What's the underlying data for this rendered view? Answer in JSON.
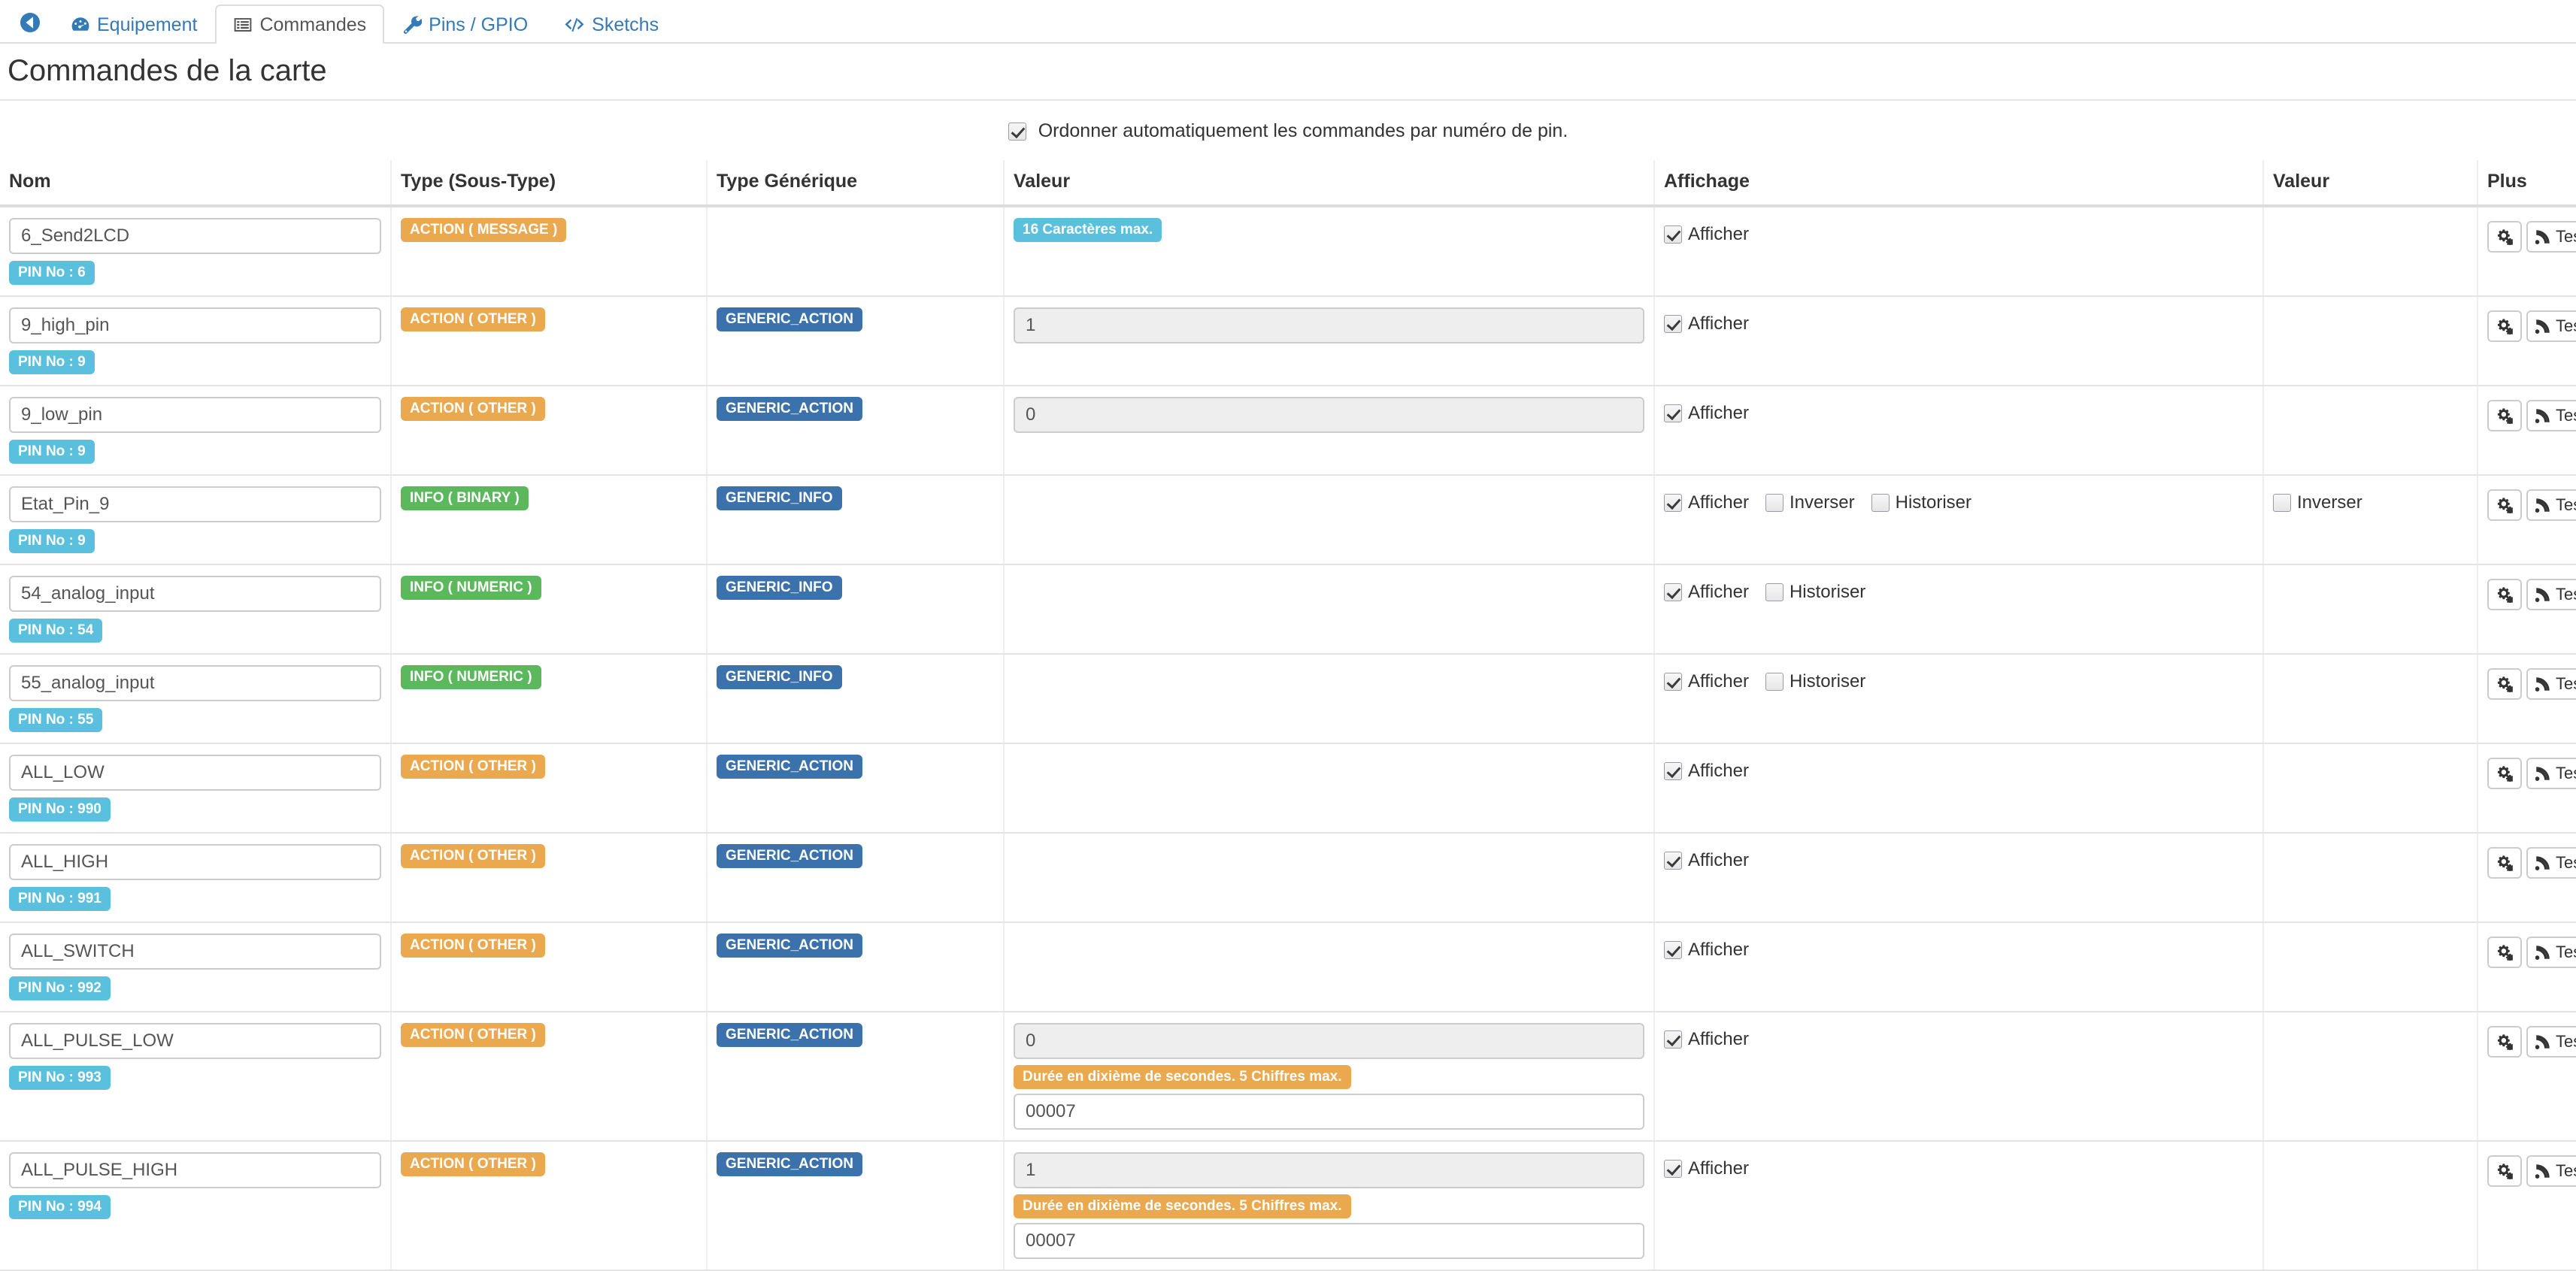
{
  "tabs": {
    "back_icon": "back-circle-icon",
    "items": [
      {
        "id": "equipement",
        "label": "Equipement",
        "icon": "dashboard-icon",
        "active": false
      },
      {
        "id": "commandes",
        "label": "Commandes",
        "icon": "list-alt-icon",
        "active": true
      },
      {
        "id": "pins-gpio",
        "label": "Pins / GPIO",
        "icon": "wrench-icon",
        "active": false
      },
      {
        "id": "sketchs",
        "label": "Sketchs",
        "icon": "code-icon",
        "active": false
      }
    ]
  },
  "page": {
    "title": "Commandes de la carte"
  },
  "order_option": {
    "label": "Ordonner automatiquement les commandes par numéro de pin.",
    "checked": true
  },
  "table": {
    "headers": {
      "nom": "Nom",
      "type": "Type (Sous-Type)",
      "generique": "Type Générique",
      "valeur": "Valeur",
      "affichage": "Affichage",
      "valeur2": "Valeur",
      "plus": "Plus"
    },
    "labels": {
      "afficher": "Afficher",
      "inverser": "Inverser",
      "historiser": "Historiser",
      "tester": "Tester",
      "config_icon": "cogs-icon",
      "tester_icon": "rss-signal-icon"
    },
    "rows": [
      {
        "name": "6_Send2LCD",
        "pin": "PIN No : 6",
        "type": "ACTION ( MESSAGE )",
        "type_color": "orange",
        "generic": "",
        "generic_color": "",
        "value": null,
        "value_hint": null,
        "value_extra": null,
        "value_info": "16 Caractères max.",
        "afficher": true,
        "inverser": null,
        "historiser": null,
        "valeur2_inverser": null
      },
      {
        "name": "9_high_pin",
        "pin": "PIN No : 9",
        "type": "ACTION ( OTHER )",
        "type_color": "orange",
        "generic": "GENERIC_ACTION",
        "generic_color": "blue",
        "value": "1",
        "value_hint": null,
        "value_extra": null,
        "value_info": null,
        "afficher": true,
        "inverser": null,
        "historiser": null,
        "valeur2_inverser": null
      },
      {
        "name": "9_low_pin",
        "pin": "PIN No : 9",
        "type": "ACTION ( OTHER )",
        "type_color": "orange",
        "generic": "GENERIC_ACTION",
        "generic_color": "blue",
        "value": "0",
        "value_hint": null,
        "value_extra": null,
        "value_info": null,
        "afficher": true,
        "inverser": null,
        "historiser": null,
        "valeur2_inverser": null
      },
      {
        "name": "Etat_Pin_9",
        "pin": "PIN No : 9",
        "type": "INFO ( BINARY )",
        "type_color": "green",
        "generic": "GENERIC_INFO",
        "generic_color": "blue",
        "value": null,
        "value_hint": null,
        "value_extra": null,
        "value_info": null,
        "afficher": true,
        "inverser": false,
        "historiser": false,
        "valeur2_inverser": false
      },
      {
        "name": "54_analog_input",
        "pin": "PIN No : 54",
        "type": "INFO ( NUMERIC )",
        "type_color": "green",
        "generic": "GENERIC_INFO",
        "generic_color": "blue",
        "value": null,
        "value_hint": null,
        "value_extra": null,
        "value_info": null,
        "afficher": true,
        "inverser": null,
        "historiser": false,
        "valeur2_inverser": null
      },
      {
        "name": "55_analog_input",
        "pin": "PIN No : 55",
        "type": "INFO ( NUMERIC )",
        "type_color": "green",
        "generic": "GENERIC_INFO",
        "generic_color": "blue",
        "value": null,
        "value_hint": null,
        "value_extra": null,
        "value_info": null,
        "afficher": true,
        "inverser": null,
        "historiser": false,
        "valeur2_inverser": null
      },
      {
        "name": "ALL_LOW",
        "pin": "PIN No : 990",
        "type": "ACTION ( OTHER )",
        "type_color": "orange",
        "generic": "GENERIC_ACTION",
        "generic_color": "blue",
        "value": null,
        "value_hint": null,
        "value_extra": null,
        "value_info": null,
        "afficher": true,
        "inverser": null,
        "historiser": null,
        "valeur2_inverser": null
      },
      {
        "name": "ALL_HIGH",
        "pin": "PIN No : 991",
        "type": "ACTION ( OTHER )",
        "type_color": "orange",
        "generic": "GENERIC_ACTION",
        "generic_color": "blue",
        "value": null,
        "value_hint": null,
        "value_extra": null,
        "value_info": null,
        "afficher": true,
        "inverser": null,
        "historiser": null,
        "valeur2_inverser": null
      },
      {
        "name": "ALL_SWITCH",
        "pin": "PIN No : 992",
        "type": "ACTION ( OTHER )",
        "type_color": "orange",
        "generic": "GENERIC_ACTION",
        "generic_color": "blue",
        "value": null,
        "value_hint": null,
        "value_extra": null,
        "value_info": null,
        "afficher": true,
        "inverser": null,
        "historiser": null,
        "valeur2_inverser": null
      },
      {
        "name": "ALL_PULSE_LOW",
        "pin": "PIN No : 993",
        "type": "ACTION ( OTHER )",
        "type_color": "orange",
        "generic": "GENERIC_ACTION",
        "generic_color": "blue",
        "value": "0",
        "value_hint": "Durée en dixième de secondes. 5 Chiffres max.",
        "value_extra": "00007",
        "value_info": null,
        "afficher": true,
        "inverser": null,
        "historiser": null,
        "valeur2_inverser": null
      },
      {
        "name": "ALL_PULSE_HIGH",
        "pin": "PIN No : 994",
        "type": "ACTION ( OTHER )",
        "type_color": "orange",
        "generic": "GENERIC_ACTION",
        "generic_color": "blue",
        "value": "1",
        "value_hint": "Durée en dixième de secondes. 5 Chiffres max.",
        "value_extra": "00007",
        "value_info": null,
        "afficher": true,
        "inverser": null,
        "historiser": null,
        "valeur2_inverser": null
      }
    ]
  },
  "colors": {
    "link": "#337ab7",
    "badge_orange": "#eaa94f",
    "badge_green": "#5cb85c",
    "badge_blue": "#3c72ab",
    "badge_info": "#5bc0de"
  }
}
